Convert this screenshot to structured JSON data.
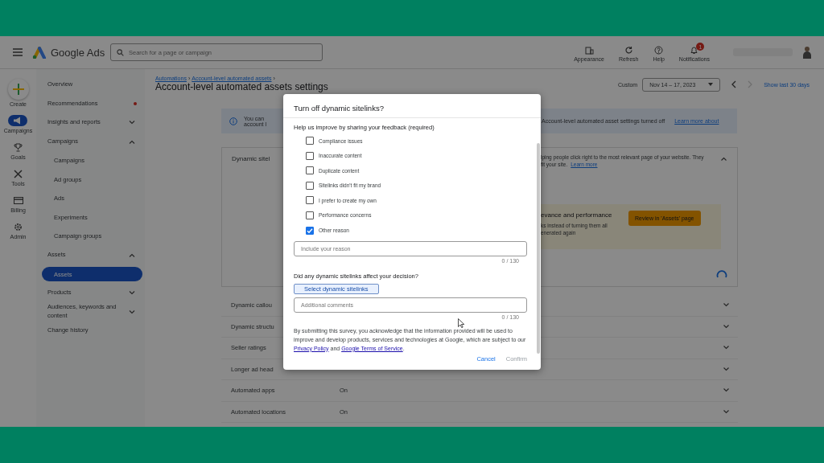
{
  "header": {
    "app_name": "Google Ads",
    "search": {
      "placeholder": "Search for a page or campaign"
    },
    "actions": [
      {
        "label": "Appearance"
      },
      {
        "label": "Refresh"
      },
      {
        "label": "Help"
      },
      {
        "label": "Notifications",
        "badge": "1"
      }
    ]
  },
  "rail": [
    {
      "label": "Create",
      "selected": false
    },
    {
      "label": "Campaigns",
      "selected": true
    },
    {
      "label": "Goals",
      "selected": false
    },
    {
      "label": "Tools",
      "selected": false
    },
    {
      "label": "Billing",
      "selected": false
    },
    {
      "label": "Admin",
      "selected": false
    }
  ],
  "nav": [
    {
      "label": "Overview",
      "kind": "item",
      "dot": false
    },
    {
      "label": "Recommendations",
      "kind": "item",
      "dot": true
    },
    {
      "label": "Insights and reports",
      "kind": "group",
      "expanded": false
    },
    {
      "label": "Campaigns",
      "kind": "group",
      "expanded": true,
      "children": [
        {
          "label": "Campaigns",
          "selected": false
        },
        {
          "label": "Ad groups",
          "selected": false
        },
        {
          "label": "Ads",
          "selected": false
        },
        {
          "label": "Experiments",
          "selected": false
        },
        {
          "label": "Campaign groups",
          "selected": false
        }
      ]
    },
    {
      "label": "Assets",
      "kind": "group",
      "expanded": true,
      "children": [
        {
          "label": "Assets",
          "selected": true
        }
      ]
    },
    {
      "label": "Products",
      "kind": "group",
      "expanded": false
    },
    {
      "label": "Audiences, keywords and content",
      "kind": "group",
      "expanded": false
    },
    {
      "label": "Change history",
      "kind": "item",
      "dot": false
    }
  ],
  "page": {
    "breadcrumb": [
      "Automations",
      "Account-level automated assets"
    ],
    "breadcrumb_separator": "›",
    "title": "Account-level automated assets settings",
    "date_label": "Custom",
    "date_range": "Nov 14 – 17, 2023",
    "show_last": "Show last 30 days"
  },
  "banner": {
    "text_start": "You can",
    "text_start_2": "account l",
    "text": "Account-level automated asset settings turned off",
    "link": "Learn more about"
  },
  "card": {
    "title": "Dynamic sitel",
    "description": "lping people click right to the most relevant page of your website. They",
    "description_2": "fit your site.",
    "link": "Learn more",
    "expanded": true,
    "notice": {
      "title": "evance and performance",
      "lines": [
        "ks instead of turning them all",
        "enerated again"
      ],
      "button": "Review in 'Assets' page"
    }
  },
  "rows": [
    {
      "label": "Dynamic callou"
    },
    {
      "label": "Dynamic structu"
    },
    {
      "label": "Seller ratings"
    },
    {
      "label": "Longer ad head"
    },
    {
      "label": "Automated apps",
      "value": "On"
    },
    {
      "label": "Automated locations",
      "value": "On"
    }
  ],
  "dialog": {
    "title": "Turn off dynamic sitelinks?",
    "prompt": "Help us improve by sharing your feedback (required)",
    "reasons": [
      {
        "label": "Compliance issues",
        "checked": false
      },
      {
        "label": "Inaccurate content",
        "checked": false
      },
      {
        "label": "Duplicate content",
        "checked": false
      },
      {
        "label": "Sitelinks didn't fit my brand",
        "checked": false
      },
      {
        "label": "I prefer to create my own",
        "checked": false
      },
      {
        "label": "Performance concerns",
        "checked": false
      },
      {
        "label": "Other reason",
        "checked": true
      }
    ],
    "reason_field": {
      "placeholder": "Include your reason",
      "counter": "0 / 130"
    },
    "question": "Did any dynamic sitelinks affect your decision?",
    "select_button": "Select dynamic sitelinks",
    "comments_field": {
      "placeholder": "Additional comments",
      "counter": "0 / 130"
    },
    "consent": {
      "text": "By submitting this survey, you acknowledge that the information provided will be used to improve and develop products, services and technologies at Google, which are subject to our",
      "link_1": "Privacy Policy",
      "joiner": "and",
      "link_2": "Google Terms of Service",
      "end": "."
    },
    "actions": [
      {
        "label": "Cancel",
        "disabled": false
      },
      {
        "label": "Confirm",
        "disabled": true
      }
    ]
  }
}
